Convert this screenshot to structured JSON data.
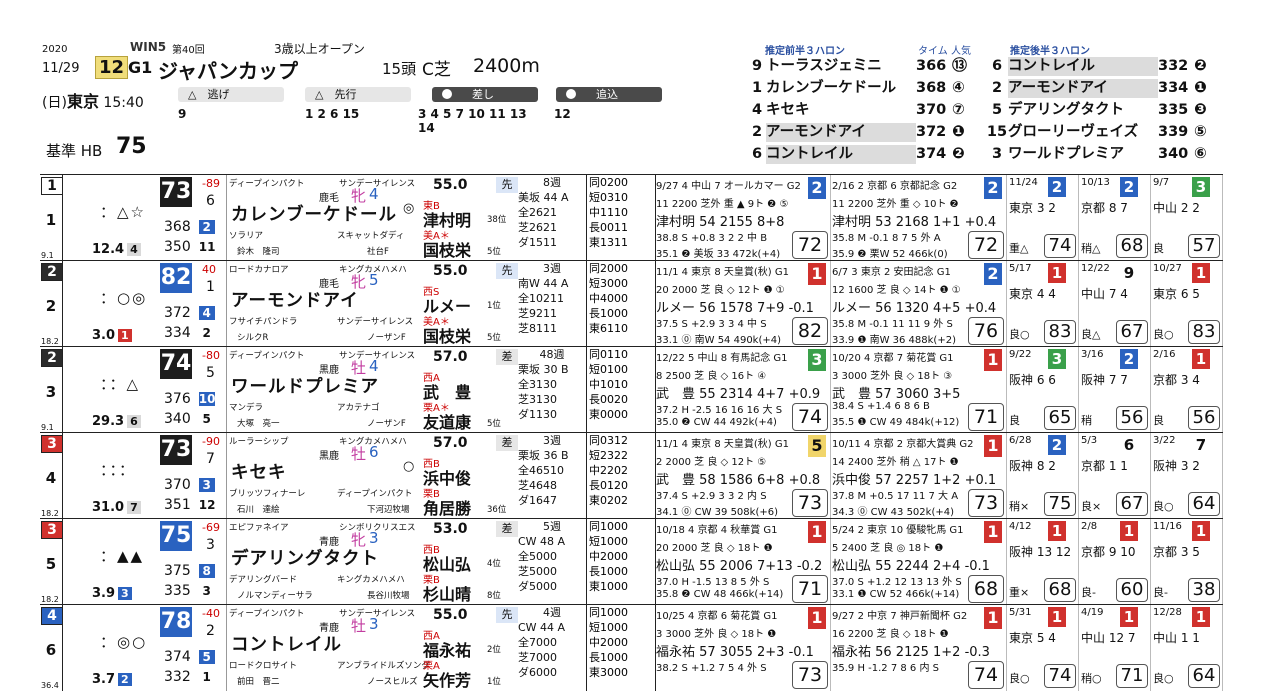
{
  "race": {
    "year": "2020",
    "date": "11/29",
    "day": "(日)",
    "venue": "東京",
    "time": "15:40",
    "race_no": "12",
    "grade": "G1",
    "win5": "WIN5",
    "edition": "第40回",
    "condition": "3歳以上オープン",
    "name": "ジャパンカップ",
    "field": "15頭",
    "course": "C芝",
    "distance": "2400m",
    "base_label": "基準 HB",
    "base_value": "75"
  },
  "styles": [
    {
      "label": "△　逃げ",
      "numbers": "9"
    },
    {
      "label": "△　先行",
      "numbers": "1 2 6 15"
    },
    {
      "label": "差し",
      "numbers": "3 4 5 7 10 11 13 14"
    },
    {
      "label": "追込",
      "numbers": "12"
    }
  ],
  "pace_front": {
    "title": "推定前半３ハロン",
    "col_time": "タイム",
    "col_pop": "人気",
    "rows": [
      {
        "no": "9",
        "name": "トーラスジェミニ",
        "time": "366",
        "pop": "⑬",
        "fill": false,
        "hl": false
      },
      {
        "no": "1",
        "name": "カレンブーケドール",
        "time": "368",
        "pop": "④",
        "fill": false,
        "hl": false
      },
      {
        "no": "4",
        "name": "キセキ",
        "time": "370",
        "pop": "⑦",
        "fill": false,
        "hl": false
      },
      {
        "no": "2",
        "name": "アーモンドアイ",
        "time": "372",
        "pop": "❶",
        "fill": true,
        "hl": true
      },
      {
        "no": "6",
        "name": "コントレイル",
        "time": "374",
        "pop": "❷",
        "fill": true,
        "hl": true
      }
    ]
  },
  "pace_back": {
    "title": "推定後半３ハロン",
    "rows": [
      {
        "no": "6",
        "name": "コントレイル",
        "time": "332",
        "pop": "❷",
        "hl": true
      },
      {
        "no": "2",
        "name": "アーモンドアイ",
        "time": "334",
        "pop": "❶",
        "hl": true
      },
      {
        "no": "5",
        "name": "デアリングタクト",
        "time": "335",
        "pop": "❸",
        "hl": false
      },
      {
        "no": "15",
        "name": "グローリーヴェイズ",
        "time": "339",
        "pop": "⑤",
        "hl": false
      },
      {
        "no": "3",
        "name": "ワールドプレミア",
        "time": "340",
        "pop": "⑥",
        "hl": false
      }
    ]
  },
  "horses": [
    {
      "frame": "1",
      "no": "1",
      "frame_color": "#ffffff",
      "frame_text": "#111",
      "rank": "9.1",
      "marks": "：△☆",
      "odds": "12.4",
      "odds_rank": "4",
      "odds_bg": "#d9d9d9",
      "index": "73",
      "idx_color": "#1d1d1d",
      "diff": "-89",
      "r1": "6",
      "v2": "368",
      "r2": "2",
      "v3": "350",
      "r3": "11",
      "sire": "ディープインパクト",
      "dam_sire": "サンデーサイレンス",
      "color": "鹿毛",
      "sex": "牝",
      "age": "4",
      "name": "カレンブーケドール",
      "mark": "◎",
      "dam": "ソラリア",
      "trainer_line": "鈴木　隆司",
      "farm": "社台F",
      "dam_sire2": "スキャットダディ",
      "weight": "55.0",
      "j_region": "東B",
      "jockey": "津村明",
      "j_age": "38位",
      "stable": "美A＊",
      "trainer": "国枝栄",
      "t_rank": "5位",
      "run": "先",
      "train1": "8週",
      "train2": "美坂 44 A",
      "train3": "全2621",
      "train4": "芝2621",
      "train5": "ダ1511",
      "rec": [
        "同0200",
        "短0310",
        "中1110",
        "長0011",
        "東1311"
      ],
      "past1": {
        "l1": "9/27 4 中山 7 オールカマー G2",
        "pos": "2",
        "l2": "11 2200 芝外 重 ▲ 9ト ❷ ⑤",
        "l3": "津村明 54 2155 8+8",
        "l4": "38.8 S +0.8 3 2 2 中 B",
        "l5": "35.1 ❷ 美坂 33 472k(+4)",
        "score": "72",
        "pos_color": "#2a62c0"
      },
      "past2": {
        "l1": "2/16 2 京都 6 京都記念 G2",
        "pos": "2",
        "l2": "11 2200 芝外 重 ◇ 10ト ❷",
        "l3": "津村明 53 2168 1+1 +0.4",
        "l4": "35.8 M -0.1 8 7 5 外 A",
        "l5": "35.9 ❷ 栗W 52 466k(0)",
        "score": "72",
        "pos_color": "#2a62c0"
      },
      "short": [
        {
          "d": "11/24",
          "p": "2",
          "pc": "#2a62c0",
          "c": "東京 3 2",
          "g": "重△",
          "s": "74"
        },
        {
          "d": "10/13",
          "p": "2",
          "pc": "#2a62c0",
          "c": "京都 8 7",
          "g": "稍△",
          "s": "68"
        },
        {
          "d": "9/7",
          "p": "3",
          "pc": "#3aa04a",
          "c": "中山 2 2",
          "g": "良",
          "s": "57"
        }
      ]
    },
    {
      "frame": "2",
      "no": "2",
      "frame_color": "#2b2b2b",
      "frame_text": "#fff",
      "rank": "18.2",
      "marks": "：○◎",
      "odds": "3.0",
      "odds_rank": "1",
      "odds_bg": "#d0312d",
      "index": "82",
      "idx_color": "#2a62c0",
      "diff": "40",
      "r1": "1",
      "v2": "372",
      "r2": "4",
      "v3": "334",
      "r3": "2",
      "sire": "ロードカナロア",
      "dam_sire": "キングカメハメハ",
      "color": "鹿毛",
      "sex": "牝",
      "age": "5",
      "name": "アーモンドアイ",
      "mark": "",
      "dam": "フサイチパンドラ",
      "trainer_line": "シルクR",
      "farm": "ノーザンF",
      "dam_sire2": "サンデーサイレンス",
      "weight": "55.0",
      "j_region": "西S",
      "jockey": "ルメー",
      "j_age": "1位",
      "stable": "美A＊",
      "trainer": "国枝栄",
      "t_rank": "5位",
      "run": "先",
      "train1": "3週",
      "train2": "南W 44 A",
      "train3": "全10211",
      "train4": "芝9211",
      "train5": "芝8111",
      "rec": [
        "同2000",
        "短3000",
        "中4000",
        "長1000",
        "東6110"
      ],
      "past1": {
        "l1": "11/1 4 東京 8 天皇賞(秋) G1",
        "pos": "1",
        "l2": "20 2000 芝 良 ◇ 12ト ❶ ①",
        "l3": "ルメー 56 1578 7+9 -0.1",
        "l4": "37.5 S +2.9 3 3 4 中 S",
        "l5": "33.1 ⓪ 南W 54 490k(+4)",
        "score": "82",
        "pos_color": "#d0312d"
      },
      "past2": {
        "l1": "6/7 3 東京 2 安田記念 G1",
        "pos": "2",
        "l2": "12 1600 芝 良 ◇ 14ト ❶ ①",
        "l3": "ルメー 56 1320 4+5 +0.4",
        "l4": "35.8 M -0.1 11 11 9 外 S",
        "l5": "33.9 ❶ 南W 36 488k(+2)",
        "score": "76",
        "pos_color": "#2a62c0"
      },
      "short": [
        {
          "d": "5/17",
          "p": "1",
          "pc": "#d0312d",
          "c": "東京 4 4",
          "g": "良○",
          "s": "83"
        },
        {
          "d": "12/22",
          "p": "9",
          "pc": "#ffffff",
          "c": "中山 7 4",
          "g": "良△",
          "s": "67"
        },
        {
          "d": "10/27",
          "p": "1",
          "pc": "#d0312d",
          "c": "東京 6 5",
          "g": "良○",
          "s": "83"
        }
      ]
    },
    {
      "frame": "2",
      "no": "3",
      "frame_color": "#2b2b2b",
      "frame_text": "#fff",
      "rank": "9.1",
      "marks": "：：△",
      "odds": "29.3",
      "odds_rank": "6",
      "odds_bg": "#d9d9d9",
      "index": "74",
      "idx_color": "#1d1d1d",
      "diff": "-80",
      "r1": "5",
      "v2": "376",
      "r2": "10",
      "v3": "340",
      "r3": "5",
      "sire": "ディープインパクト",
      "dam_sire": "サンデーサイレンス",
      "color": "黒鹿",
      "sex": "牡",
      "age": "4",
      "name": "ワールドプレミア",
      "mark": "",
      "dam": "マンデラ",
      "trainer_line": "大塚　亮一",
      "farm": "ノーザンF",
      "dam_sire2": "アカテナゴ",
      "weight": "57.0",
      "j_region": "西A",
      "jockey": "武　豊",
      "j_age": "",
      "stable": "栗A＊",
      "trainer": "友道康",
      "t_rank": "5位",
      "run": "差",
      "train1": "48週",
      "train2": "栗坂 30 B",
      "train3": "全3130",
      "train4": "芝3130",
      "train5": "ダ1130",
      "rec": [
        "同0110",
        "短0100",
        "中1010",
        "長0020",
        "東0000"
      ],
      "past1": {
        "l1": "12/22 5 中山 8 有馬記念 G1",
        "pos": "3",
        "l2": "8 2500 芝 良 ◇ 16ト ④",
        "l3": "武　豊 55 2314 4+7 +0.9",
        "l4": "37.2 H -2.5 16 16 16 大 S",
        "l5": "35.0 ❷ CW 44 492k(+4)",
        "score": "74",
        "pos_color": "#3aa04a"
      },
      "past2": {
        "l1": "10/20 4 京都 7 菊花賞 G1",
        "pos": "1",
        "l2": "3 3000 芝外 良 ◇ 18ト ③",
        "l3": "武　豊 57 3060 3+5",
        "l4": "38.4 S +1.4 6 8 6 B",
        "l5": "35.5 ❶ CW 49 484k(+12)",
        "score": "71",
        "pos_color": "#d0312d"
      },
      "short": [
        {
          "d": "9/22",
          "p": "3",
          "pc": "#3aa04a",
          "c": "阪神 6 6",
          "g": "良",
          "s": "65"
        },
        {
          "d": "3/16",
          "p": "2",
          "pc": "#2a62c0",
          "c": "阪神 7 7",
          "g": "稍",
          "s": "56"
        },
        {
          "d": "2/16",
          "p": "1",
          "pc": "#d0312d",
          "c": "京都 3 4",
          "g": "良",
          "s": "56"
        }
      ]
    },
    {
      "frame": "3",
      "no": "4",
      "frame_color": "#d0312d",
      "frame_text": "#fff",
      "rank": "18.2",
      "marks": "：：：",
      "odds": "31.0",
      "odds_rank": "7",
      "odds_bg": "#d9d9d9",
      "index": "73",
      "idx_color": "#1d1d1d",
      "diff": "-90",
      "r1": "7",
      "v2": "370",
      "r2": "3",
      "v3": "351",
      "r3": "12",
      "sire": "ルーラーシップ",
      "dam_sire": "キングカメハメハ",
      "color": "黒鹿",
      "sex": "牡",
      "age": "6",
      "name": "キセキ",
      "mark": "○",
      "dam": "ブリッツフィナーレ",
      "trainer_line": "石川　達絵",
      "farm": "下河辺牧場",
      "dam_sire2": "ディープインパクト",
      "weight": "57.0",
      "j_region": "西B",
      "jockey": "浜中俊",
      "j_age": "",
      "stable": "栗B",
      "trainer": "角居勝",
      "t_rank": "36位",
      "run": "差",
      "train1": "3週",
      "train2": "栗坂 36 B",
      "train3": "全46510",
      "train4": "芝4648",
      "train5": "ダ1647",
      "rec": [
        "同0312",
        "短2322",
        "中2202",
        "長0120",
        "東0202"
      ],
      "past1": {
        "l1": "11/1 4 東京 8 天皇賞(秋) G1",
        "pos": "5",
        "l2": "2 2000 芝 良 ◇ 12ト ⑤",
        "l3": "武　豊 58 1586 6+8 +0.8",
        "l4": "37.4 S +2.9 3 3 2 内 S",
        "l5": "34.1 ⓪ CW 39 508k(+6)",
        "score": "73",
        "pos_color": "#f1d56a"
      },
      "past2": {
        "l1": "10/11 4 京都 2 京都大賞典 G2",
        "pos": "1",
        "l2": "14 2400 芝外 稍 △ 17ト ❶",
        "l3": "浜中俊 57 2257 1+2 +0.1",
        "l4": "37.8 M +0.5 17 11 7 大 A",
        "l5": "34.3 ⓪ CW 43 502k(+4)",
        "score": "73",
        "pos_color": "#d0312d"
      },
      "short": [
        {
          "d": "6/28",
          "p": "2",
          "pc": "#2a62c0",
          "c": "阪神 8 2",
          "g": "稍×",
          "s": "75"
        },
        {
          "d": "5/3",
          "p": "6",
          "pc": "#ffffff",
          "c": "京都 1 1",
          "g": "良×",
          "s": "67"
        },
        {
          "d": "3/22",
          "p": "7",
          "pc": "#ffffff",
          "c": "阪神 3 2",
          "g": "良○",
          "s": "64"
        }
      ]
    },
    {
      "frame": "3",
      "no": "5",
      "frame_color": "#d0312d",
      "frame_text": "#fff",
      "rank": "18.2",
      "marks": "：▲▲",
      "odds": "3.9",
      "odds_rank": "3",
      "odds_bg": "#2a62c0",
      "index": "75",
      "idx_color": "#2a62c0",
      "diff": "-69",
      "r1": "3",
      "v2": "375",
      "r2": "8",
      "v3": "335",
      "r3": "3",
      "sire": "エピファネイア",
      "dam_sire": "シンボリクリスエス",
      "color": "青鹿",
      "sex": "牝",
      "age": "3",
      "name": "デアリングタクト",
      "mark": "",
      "dam": "デアリングバード",
      "trainer_line": "ノルマンディーサラ",
      "farm": "長谷川牧場",
      "dam_sire2": "キングカメハメハ",
      "weight": "53.0",
      "j_region": "西B",
      "jockey": "松山弘",
      "j_age": "4位",
      "stable": "栗B",
      "trainer": "杉山晴",
      "t_rank": "8位",
      "run": "差",
      "train1": "5週",
      "train2": "CW 48 A",
      "train3": "全5000",
      "train4": "芝5000",
      "train5": "ダ5000",
      "rec": [
        "同1000",
        "短1000",
        "中2000",
        "長1000",
        "東1000"
      ],
      "past1": {
        "l1": "10/18 4 京都 4 秋華賞 G1",
        "pos": "1",
        "l2": "20 2000 芝 良 ◇ 18ト ❶",
        "l3": "松山弘 55 2006 7+13 -0.2",
        "l4": "37.0 H -1.5 13 8 5 外 S",
        "l5": "35.8 ❷ CW 48 466k(+14)",
        "score": "71",
        "pos_color": "#d0312d"
      },
      "past2": {
        "l1": "5/24 2 東京 10 優駿牝馬 G1",
        "pos": "1",
        "l2": "5 2400 芝 良 ◎ 18ト ❶",
        "l3": "松山弘 55 2244 2+4 -0.1",
        "l4": "37.0 S +1.2 12 13 13 外 S",
        "l5": "33.1 ❶ CW 52 466k(+14)",
        "score": "68",
        "pos_color": "#d0312d"
      },
      "short": [
        {
          "d": "4/12",
          "p": "1",
          "pc": "#d0312d",
          "c": "阪神 13 12",
          "g": "重×",
          "s": "68"
        },
        {
          "d": "2/8",
          "p": "1",
          "pc": "#d0312d",
          "c": "京都 9 10",
          "g": "良-",
          "s": "60"
        },
        {
          "d": "11/16",
          "p": "1",
          "pc": "#d0312d",
          "c": "京都 3 5",
          "g": "良-",
          "s": "38"
        }
      ]
    },
    {
      "frame": "4",
      "no": "6",
      "frame_color": "#2a62c0",
      "frame_text": "#fff",
      "rank": "36.4",
      "marks": "：◎○",
      "odds": "3.7",
      "odds_rank": "2",
      "odds_bg": "#2a62c0",
      "index": "78",
      "idx_color": "#2a62c0",
      "diff": "-40",
      "r1": "2",
      "v2": "374",
      "r2": "5",
      "v3": "332",
      "r3": "1",
      "sire": "ディープインパクト",
      "dam_sire": "サンデーサイレンス",
      "color": "青鹿",
      "sex": "牡",
      "age": "3",
      "name": "コントレイル",
      "mark": "",
      "dam": "ロードクロサイト",
      "trainer_line": "前田　晋二",
      "farm": "ノースヒルズ",
      "dam_sire2": "アンブライドルズソング",
      "weight": "55.0",
      "j_region": "西A",
      "jockey": "福永祐",
      "j_age": "2位",
      "stable": "栗A",
      "trainer": "矢作芳",
      "t_rank": "1位",
      "run": "先",
      "train1": "4週",
      "train2": "CW 44 A",
      "train3": "全7000",
      "train4": "芝7000",
      "train5": "ダ6000",
      "rec": [
        "同1000",
        "短1000",
        "中2000",
        "長1000",
        "東3000"
      ],
      "past1": {
        "l1": "10/25 4 京都 6 菊花賞 G1",
        "pos": "1",
        "l2": "3 3000 芝外 良 ◇ 18ト ❶",
        "l3": "福永祐 57 3055 2+3 -0.1",
        "l4": "38.2 S +1.2 7 5 4 外 S",
        "l5": "",
        "score": "73",
        "pos_color": "#d0312d"
      },
      "past2": {
        "l1": "9/27 2 中京 7 神戸新聞杯 G2",
        "pos": "1",
        "l2": "16 2200 芝 良 ◇ 18ト ❶",
        "l3": "福永祐 56 2125 1+2 -0.3",
        "l4": "35.9 H -1.2 7 8 6 内 S",
        "l5": "",
        "score": "74",
        "pos_color": "#d0312d"
      },
      "short": [
        {
          "d": "5/31",
          "p": "1",
          "pc": "#d0312d",
          "c": "東京 5 4",
          "g": "良○",
          "s": "74"
        },
        {
          "d": "4/19",
          "p": "1",
          "pc": "#d0312d",
          "c": "中山 12 7",
          "g": "稍○",
          "s": "71"
        },
        {
          "d": "12/28",
          "p": "1",
          "pc": "#d0312d",
          "c": "中山 1 1",
          "g": "良○",
          "s": "64"
        }
      ]
    }
  ]
}
